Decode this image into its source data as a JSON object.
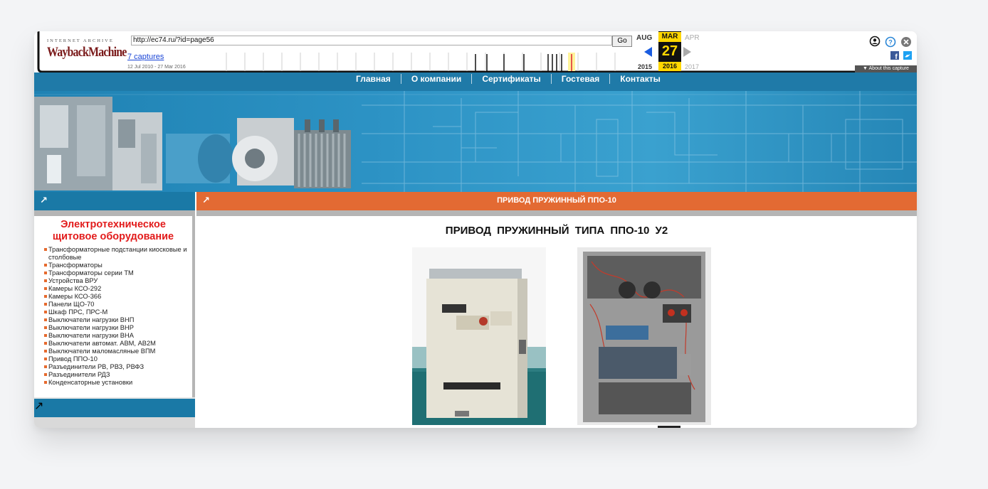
{
  "wayback": {
    "logo_top": "INTERNET ARCHIVE",
    "logo_mark": "WaybackMachine",
    "url_value": "http://ec74.ru/?id=page56",
    "go_label": "Go",
    "captures_link": "7 captures",
    "captures_range": "12 Jul 2010 - 27 Mar 2016",
    "months": {
      "prev": "AUG",
      "current": "MAR",
      "next": "APR"
    },
    "day": "27",
    "years": {
      "prev": "2015",
      "current": "2016",
      "next": "2017"
    },
    "about_label": "▼ About this capture",
    "icons": [
      "user-icon",
      "help-icon",
      "close-icon",
      "facebook-icon",
      "twitter-icon"
    ]
  },
  "site": {
    "nav": [
      "Главная",
      "О компании",
      "Сертификаты",
      "Гостевая",
      "Контакты"
    ],
    "sidebar_title": "Электротехническое щитовое оборудование",
    "sidebar_items": [
      "Трансформаторные подстанции киосковые и столбовые",
      "Трансформаторы",
      "Трансформаторы серии ТМ",
      "Устройства ВРУ",
      "Камеры КСО-292",
      "Камеры КСО-366",
      "Панели ЩО-70",
      "Шкаф ПРС, ПРС-М",
      "Выключатели нагрузки ВНП",
      "Выключатели нагрузки ВНР",
      "Выключатели нагрузки ВНА",
      "Выключатели автомат. АВМ, АВ2М",
      "Выключатели маломасляные ВПМ",
      "Привод ППО-10",
      "Разъединители РВ, РВЗ, РВФЗ",
      "Разъединители РДЗ",
      "Конденсаторные установки"
    ],
    "section_header": "ПРИВОД ПРУЖИННЫЙ ППО-10",
    "product_title": "ПРИВОД ПРУЖИННЫЙ ТИПА ППО-10 У2",
    "arrow_glyph": "↗",
    "colors": {
      "nav_blue": "#1f7aa8",
      "header_orange": "#e36a33",
      "title_red": "#e21b1b"
    }
  }
}
